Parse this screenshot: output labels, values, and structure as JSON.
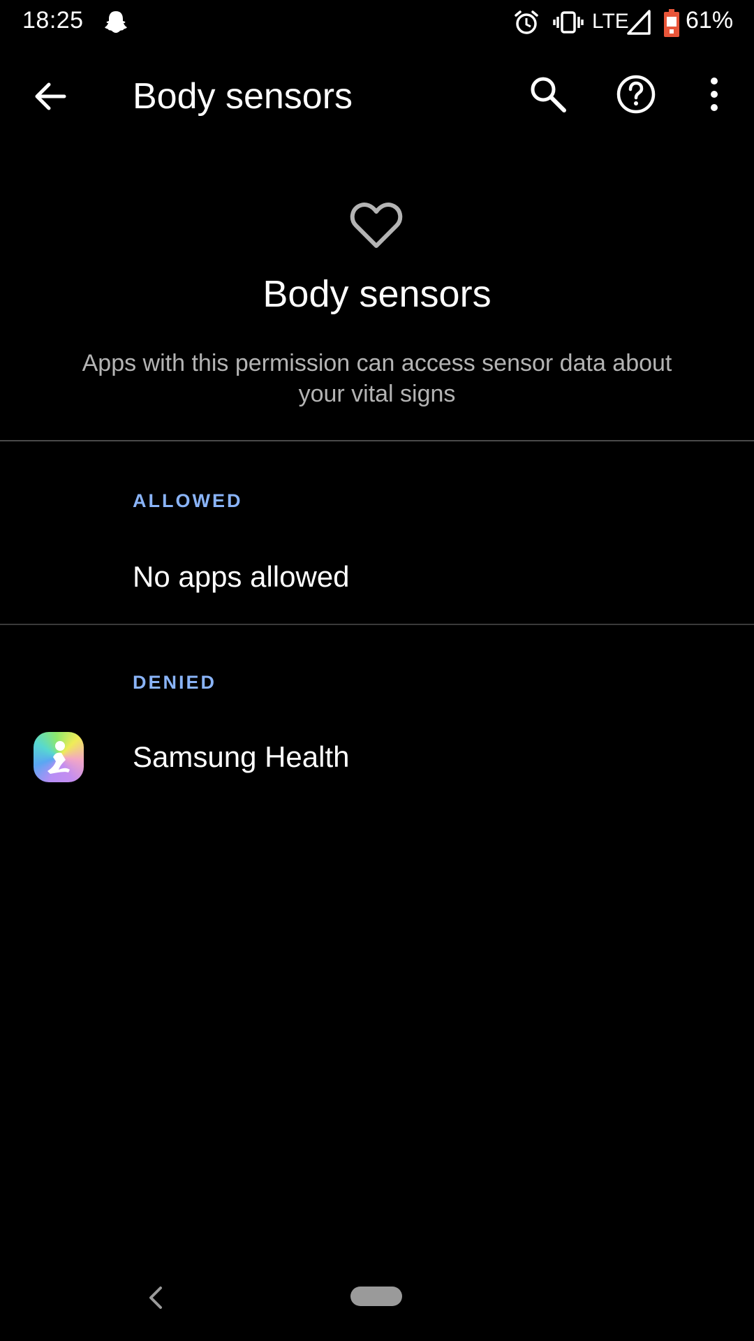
{
  "status_bar": {
    "time": "18:25",
    "network": "LTE",
    "battery": "61%",
    "icons": [
      "snapchat-ghost-icon",
      "alarm-icon",
      "vibrate-icon",
      "signal-icon",
      "battery-icon"
    ]
  },
  "toolbar": {
    "title": "Body sensors",
    "icons": [
      "back-arrow-icon",
      "search-icon",
      "help-icon",
      "more-vert-icon"
    ]
  },
  "header": {
    "icon": "heart-icon",
    "title": "Body sensors",
    "description": "Apps with this permission can access sensor data about your vital signs"
  },
  "sections": {
    "allowed": {
      "label": "ALLOWED",
      "empty_text": "No apps allowed"
    },
    "denied": {
      "label": "DENIED",
      "apps": [
        {
          "name": "Samsung Health",
          "icon": "samsung-health-icon"
        }
      ]
    }
  },
  "nav_bar": {
    "icons": [
      "nav-back-icon",
      "home-pill"
    ]
  },
  "colors": {
    "background": "#000000",
    "section_label": "#8ab4f8",
    "secondary_text": "#b4b4b4",
    "divider": "#4a4a4a"
  }
}
